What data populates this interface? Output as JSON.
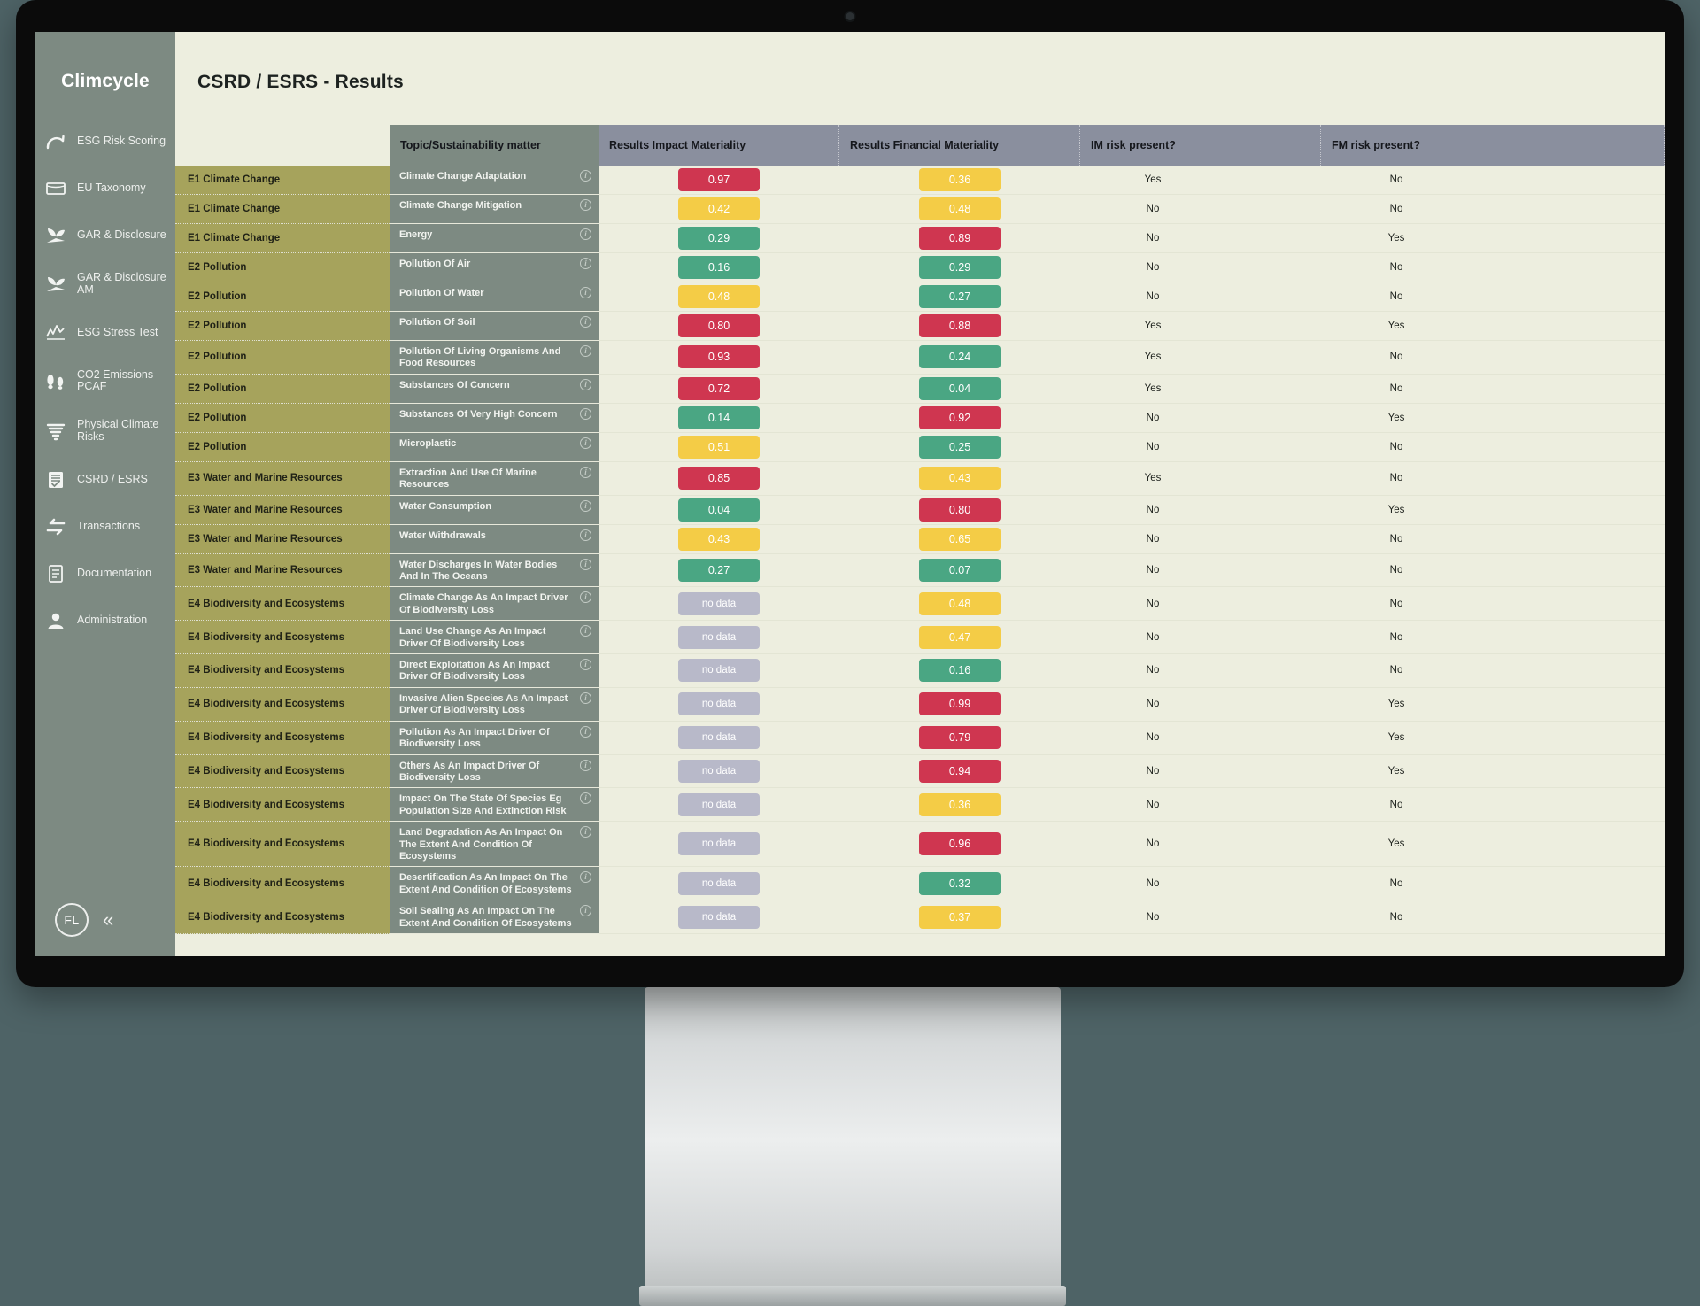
{
  "brand": {
    "name": "Climcycle"
  },
  "sidebar": {
    "items": [
      {
        "label": "ESG Risk Scoring",
        "icon": "gauge-icon"
      },
      {
        "label": "EU Taxonomy",
        "icon": "document-card-icon"
      },
      {
        "label": "GAR & Disclosure",
        "icon": "leaf-icon"
      },
      {
        "label": "GAR & Disclosure AM",
        "icon": "leaf-icon"
      },
      {
        "label": "ESG Stress Test",
        "icon": "line-chart-icon"
      },
      {
        "label": "CO2 Emissions PCAF",
        "icon": "footprint-icon"
      },
      {
        "label": "Physical Climate Risks",
        "icon": "tornado-icon"
      },
      {
        "label": "CSRD / ESRS",
        "icon": "checklist-icon"
      },
      {
        "label": "Transactions",
        "icon": "exchange-arrows-icon"
      },
      {
        "label": "Documentation",
        "icon": "file-text-icon"
      },
      {
        "label": "Administration",
        "icon": "user-icon"
      }
    ],
    "avatar_initials": "FL",
    "collapse_label": "«"
  },
  "page": {
    "title": "CSRD / ESRS - Results"
  },
  "table": {
    "headers": {
      "topic_blank": "",
      "matter": "Topic/Sustainability matter",
      "impact": "Results Impact Materiality",
      "financial": "Results Financial Materiality",
      "im_risk": "IM risk present?",
      "fm_risk": "FM risk present?"
    },
    "info_glyph": "i",
    "rows": [
      {
        "topic": "E1 Climate Change",
        "matter": "Climate Change Adaptation",
        "im": "0.97",
        "im_color": "red",
        "fm": "0.36",
        "fm_color": "amber",
        "im_risk": "Yes",
        "fm_risk": "No"
      },
      {
        "topic": "E1 Climate Change",
        "matter": "Climate Change Mitigation",
        "im": "0.42",
        "im_color": "amber",
        "fm": "0.48",
        "fm_color": "amber",
        "im_risk": "No",
        "fm_risk": "No"
      },
      {
        "topic": "E1 Climate Change",
        "matter": "Energy",
        "im": "0.29",
        "im_color": "green",
        "fm": "0.89",
        "fm_color": "red",
        "im_risk": "No",
        "fm_risk": "Yes"
      },
      {
        "topic": "E2 Pollution",
        "matter": "Pollution Of Air",
        "im": "0.16",
        "im_color": "green",
        "fm": "0.29",
        "fm_color": "green",
        "im_risk": "No",
        "fm_risk": "No"
      },
      {
        "topic": "E2 Pollution",
        "matter": "Pollution Of Water",
        "im": "0.48",
        "im_color": "amber",
        "fm": "0.27",
        "fm_color": "green",
        "im_risk": "No",
        "fm_risk": "No"
      },
      {
        "topic": "E2 Pollution",
        "matter": "Pollution Of Soil",
        "im": "0.80",
        "im_color": "red",
        "fm": "0.88",
        "fm_color": "red",
        "im_risk": "Yes",
        "fm_risk": "Yes"
      },
      {
        "topic": "E2 Pollution",
        "matter": "Pollution Of Living Organisms And Food Resources",
        "im": "0.93",
        "im_color": "red",
        "fm": "0.24",
        "fm_color": "green",
        "im_risk": "Yes",
        "fm_risk": "No"
      },
      {
        "topic": "E2 Pollution",
        "matter": "Substances Of Concern",
        "im": "0.72",
        "im_color": "red",
        "fm": "0.04",
        "fm_color": "green",
        "im_risk": "Yes",
        "fm_risk": "No"
      },
      {
        "topic": "E2 Pollution",
        "matter": "Substances Of Very High Concern",
        "im": "0.14",
        "im_color": "green",
        "fm": "0.92",
        "fm_color": "red",
        "im_risk": "No",
        "fm_risk": "Yes"
      },
      {
        "topic": "E2 Pollution",
        "matter": "Microplastic",
        "im": "0.51",
        "im_color": "amber",
        "fm": "0.25",
        "fm_color": "green",
        "im_risk": "No",
        "fm_risk": "No"
      },
      {
        "topic": "E3 Water and Marine Resources",
        "matter": "Extraction And Use Of Marine Resources",
        "im": "0.85",
        "im_color": "red",
        "fm": "0.43",
        "fm_color": "amber",
        "im_risk": "Yes",
        "fm_risk": "No"
      },
      {
        "topic": "E3 Water and Marine Resources",
        "matter": "Water Consumption",
        "im": "0.04",
        "im_color": "green",
        "fm": "0.80",
        "fm_color": "red",
        "im_risk": "No",
        "fm_risk": "Yes"
      },
      {
        "topic": "E3 Water and Marine Resources",
        "matter": "Water Withdrawals",
        "im": "0.43",
        "im_color": "amber",
        "fm": "0.65",
        "fm_color": "amber",
        "im_risk": "No",
        "fm_risk": "No"
      },
      {
        "topic": "E3 Water and Marine Resources",
        "matter": "Water Discharges In Water Bodies And In The Oceans",
        "im": "0.27",
        "im_color": "green",
        "fm": "0.07",
        "fm_color": "green",
        "im_risk": "No",
        "fm_risk": "No"
      },
      {
        "topic": "E4 Biodiversity and Ecosystems",
        "matter": "Climate Change As An Impact Driver Of Biodiversity Loss",
        "im": "no data",
        "im_color": "nodata",
        "fm": "0.48",
        "fm_color": "amber",
        "im_risk": "No",
        "fm_risk": "No"
      },
      {
        "topic": "E4 Biodiversity and Ecosystems",
        "matter": "Land Use Change As An Impact Driver Of Biodiversity Loss",
        "im": "no data",
        "im_color": "nodata",
        "fm": "0.47",
        "fm_color": "amber",
        "im_risk": "No",
        "fm_risk": "No"
      },
      {
        "topic": "E4 Biodiversity and Ecosystems",
        "matter": "Direct Exploitation As An Impact Driver Of Biodiversity Loss",
        "im": "no data",
        "im_color": "nodata",
        "fm": "0.16",
        "fm_color": "green",
        "im_risk": "No",
        "fm_risk": "No"
      },
      {
        "topic": "E4 Biodiversity and Ecosystems",
        "matter": "Invasive Alien Species As An Impact Driver Of Biodiversity Loss",
        "im": "no data",
        "im_color": "nodata",
        "fm": "0.99",
        "fm_color": "red",
        "im_risk": "No",
        "fm_risk": "Yes"
      },
      {
        "topic": "E4 Biodiversity and Ecosystems",
        "matter": "Pollution As An Impact Driver Of Biodiversity Loss",
        "im": "no data",
        "im_color": "nodata",
        "fm": "0.79",
        "fm_color": "red",
        "im_risk": "No",
        "fm_risk": "Yes"
      },
      {
        "topic": "E4 Biodiversity and Ecosystems",
        "matter": "Others As An Impact Driver Of Biodiversity Loss",
        "im": "no data",
        "im_color": "nodata",
        "fm": "0.94",
        "fm_color": "red",
        "im_risk": "No",
        "fm_risk": "Yes"
      },
      {
        "topic": "E4 Biodiversity and Ecosystems",
        "matter": "Impact On The State Of Species Eg Population Size And Extinction Risk",
        "im": "no data",
        "im_color": "nodata",
        "fm": "0.36",
        "fm_color": "amber",
        "im_risk": "No",
        "fm_risk": "No"
      },
      {
        "topic": "E4 Biodiversity and Ecosystems",
        "matter": "Land Degradation As An Impact On The Extent And Condition Of Ecosystems",
        "im": "no data",
        "im_color": "nodata",
        "fm": "0.96",
        "fm_color": "red",
        "im_risk": "No",
        "fm_risk": "Yes"
      },
      {
        "topic": "E4 Biodiversity and Ecosystems",
        "matter": "Desertification As An Impact On The Extent And Condition Of Ecosystems",
        "im": "no data",
        "im_color": "nodata",
        "fm": "0.32",
        "fm_color": "green",
        "im_risk": "No",
        "fm_risk": "No"
      },
      {
        "topic": "E4 Biodiversity and Ecosystems",
        "matter": "Soil Sealing As An Impact On The Extent And Condition Of Ecosystems",
        "im": "no data",
        "im_color": "nodata",
        "fm": "0.37",
        "fm_color": "amber",
        "im_risk": "No",
        "fm_risk": "No"
      }
    ]
  },
  "colors": {
    "sidebar": "#7d8a82",
    "canvas": "#edeedf",
    "topic_cell": "#a6a35c",
    "header": "#8a8f9e",
    "red": "#cf3650",
    "amber": "#f4cc46",
    "green": "#4aa683",
    "nodata": "#b8b9c9",
    "desk": "#4e6366"
  }
}
